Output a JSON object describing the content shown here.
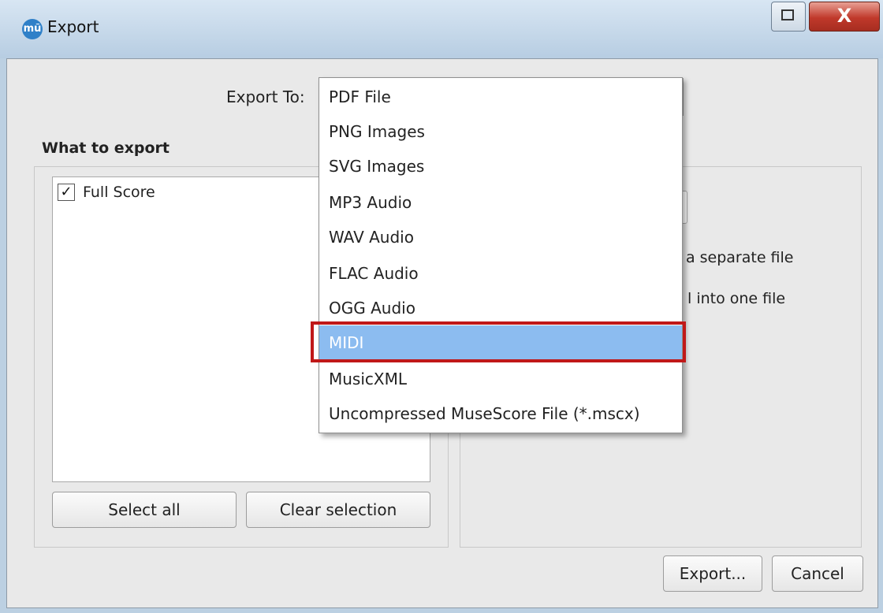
{
  "window": {
    "title": "Export",
    "app_icon_glyph": "mũ",
    "close_glyph": "X"
  },
  "export_to": {
    "label": "Export To:",
    "selected": "MIDI",
    "options": [
      "PDF File",
      "PNG Images",
      "SVG Images",
      "MP3 Audio",
      "WAV Audio",
      "FLAC Audio",
      "OGG Audio",
      "MIDI",
      "MusicXML",
      "Uncompressed MuseScore File (*.mscx)"
    ]
  },
  "what_to_export": {
    "title": "What to export",
    "items": [
      {
        "label": "Full Score",
        "checked": true,
        "check_glyph": "✓"
      }
    ],
    "select_all_label": "Select all",
    "clear_selection_label": "Clear selection"
  },
  "options_panel": {
    "partial_text_1": "s a separate file",
    "partial_text_2": "l into one file"
  },
  "footer": {
    "export_label": "Export...",
    "cancel_label": "Cancel"
  },
  "colors": {
    "highlight_box": "#c01818",
    "selected_item_bg": "#8cbcf0",
    "close_button": "#c0392b"
  }
}
